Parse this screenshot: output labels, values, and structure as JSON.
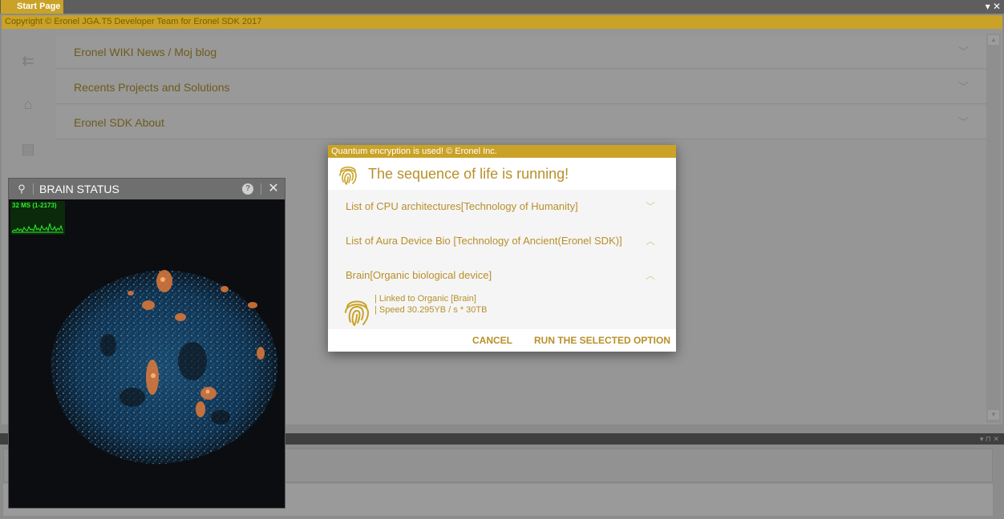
{
  "tabs": {
    "start_page": "Start Page"
  },
  "copyright": "Copyright © Eronel JGA.T5 Developer Team for Eronel SDK 2017",
  "accordion": [
    {
      "label": "Eronel WIKI News / Moj blog"
    },
    {
      "label": "Recents Projects and Solutions"
    },
    {
      "label": "Eronel SDK About"
    }
  ],
  "brain_panel": {
    "title": "BRAIN STATUS",
    "stats": "32 MS (1-2173)"
  },
  "dialog": {
    "banner": "Quantum encryption is used! © Eronel Inc.",
    "title": "The sequence of life is running!",
    "items": [
      {
        "label": "List of CPU architectures[Technology of Humanity]",
        "state": "collapsed"
      },
      {
        "label": "List of Aura Device Bio [Technology of Ancient(Eronel SDK)]",
        "state": "expanded"
      },
      {
        "label": "Brain[Organic biological device]",
        "state": "expanded"
      }
    ],
    "details": [
      "| Linked to Organic [Brain]",
      "| Speed 30.295YB / s * 30TB"
    ],
    "cancel": "CANCEL",
    "run": "RUN THE SELECTED OPTION"
  },
  "colors": {
    "accent": "#c9a227",
    "text_gold": "#b8902a"
  },
  "icons": [
    "pin-icon",
    "help-icon",
    "close-icon",
    "fingerprint-icon",
    "chevron-down-icon",
    "chevron-up-icon",
    "back-arrow-icon",
    "home-icon"
  ]
}
